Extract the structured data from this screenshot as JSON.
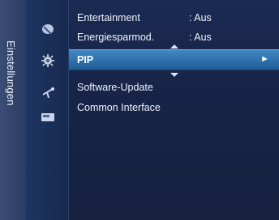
{
  "sidebar": {
    "title": "Einstellungen",
    "icons": [
      "settings-satellite-icon",
      "gear-icon",
      "antenna-icon",
      "card-icon"
    ]
  },
  "menu": {
    "items": [
      {
        "label": "Entertainment",
        "value": ": Aus"
      },
      {
        "label": "Energiesparmod.",
        "value": ": Aus"
      },
      {
        "label": "PIP",
        "arrow": "►"
      },
      {
        "label": "Software-Update"
      },
      {
        "label": "Common Interface"
      }
    ]
  },
  "colors": {
    "background": "#172447",
    "selection": "#2f76b3",
    "text": "#f0f4ff"
  }
}
